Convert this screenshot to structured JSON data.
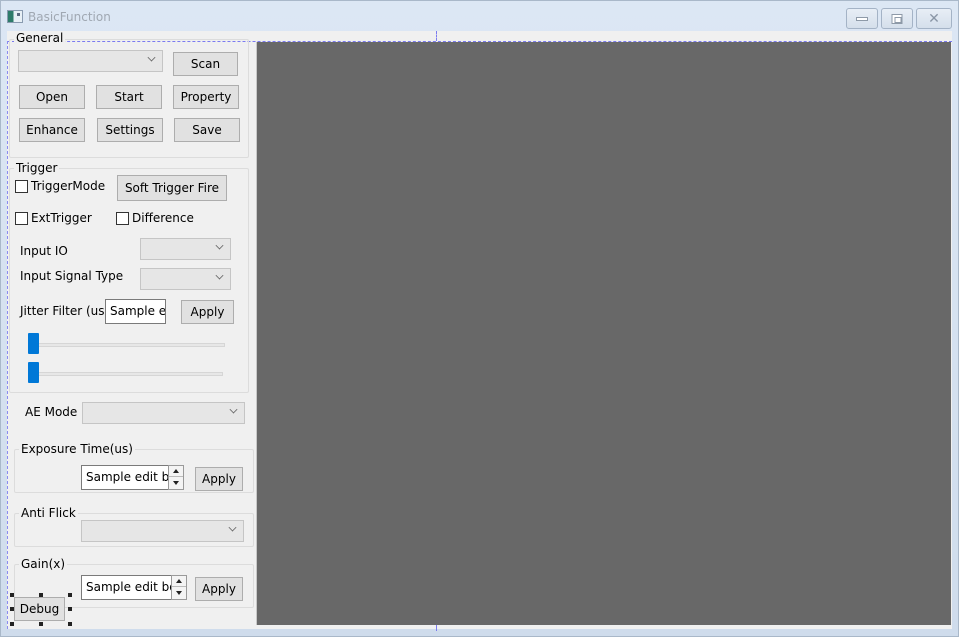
{
  "window": {
    "title": "BasicFunction",
    "icon": "app-window-icon",
    "controls": {
      "minimize": "minimize-icon",
      "maximize": "maximize-icon",
      "close": "close-icon"
    }
  },
  "general": {
    "label": "General",
    "device_combo_value": "",
    "buttons": {
      "scan": "Scan",
      "open": "Open",
      "start": "Start",
      "property": "Property",
      "enhance": "Enhance",
      "settings": "Settings",
      "save": "Save"
    }
  },
  "trigger": {
    "label": "Trigger",
    "trigger_mode": {
      "label": "TriggerMode",
      "checked": false
    },
    "soft_trigger_fire": "Soft Trigger Fire",
    "ext_trigger": {
      "label": "ExtTrigger",
      "checked": false
    },
    "difference": {
      "label": "Difference",
      "checked": false
    },
    "input_io": {
      "label": "Input IO",
      "value": ""
    },
    "input_signal_type": {
      "label": "Input Signal Type",
      "value": ""
    },
    "jitter_filter": {
      "label": "Jitter Filter (us)",
      "value": "Sample ec",
      "apply": "Apply"
    },
    "sliders": [
      {
        "value": 0
      },
      {
        "value": 0
      }
    ]
  },
  "ae_mode": {
    "label": "AE Mode",
    "value": ""
  },
  "exposure": {
    "label": "Exposure Time(us)",
    "value": "Sample edit box",
    "apply": "Apply"
  },
  "anti_flick": {
    "label": "Anti Flick",
    "value": ""
  },
  "gain": {
    "label": "Gain(x)",
    "value": "Sample edit box",
    "apply": "Apply"
  },
  "debug": {
    "label": "Debug"
  },
  "colors": {
    "video_background": "#686868",
    "slider_thumb": "#0078d7",
    "design_guide": "#7b7bf0"
  }
}
